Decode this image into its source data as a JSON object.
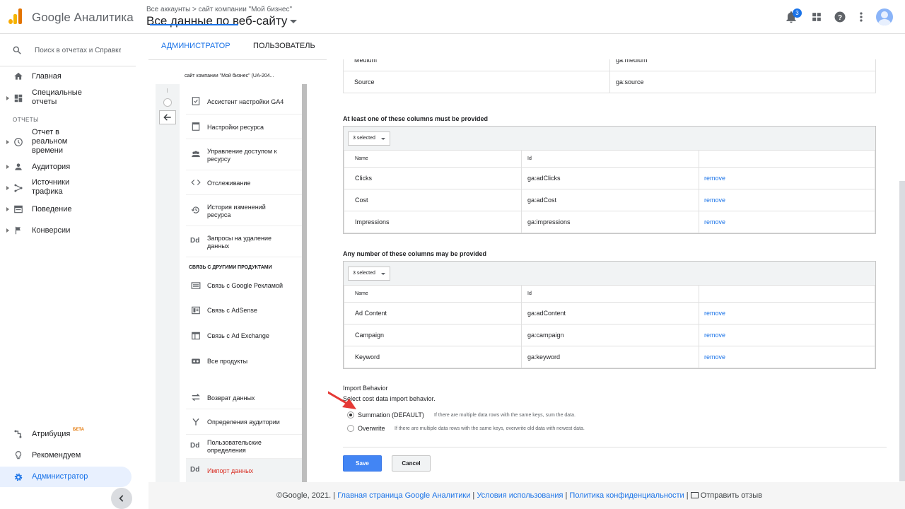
{
  "header": {
    "brand": "Google Аналитика",
    "breadcrumb": "Все аккаунты > сайт компании \"Мой бизнес\"",
    "property": "Все данные по веб-сайту",
    "notifications_count": "3"
  },
  "sidebar": {
    "search_placeholder": "Поиск в отчетах и Справке",
    "home": "Главная",
    "custom_reports": "Специальные отчеты",
    "reports_section": "ОТЧЕТЫ",
    "realtime": "Отчет в реальном времени",
    "audience": "Аудитория",
    "acquisition": "Источники трафика",
    "behavior": "Поведение",
    "conversions": "Конверсии",
    "attribution": "Атрибуция",
    "attribution_badge": "БЕТА",
    "discover": "Рекомендуем",
    "admin": "Администратор"
  },
  "tabs": {
    "admin": "АДМИНИСТРАТОР",
    "user": "ПОЛЬЗОВАТЕЛЬ"
  },
  "property_column": {
    "account": "сайт компании \"Мой бизнес\" (UA-204...",
    "items": [
      "Ассистент настройки GA4",
      "Настройки ресурса",
      "Управление доступом к ресурсу",
      "Отслеживание",
      "История изменений ресурса",
      "Запросы на удаление данных"
    ],
    "linking_header": "СВЯЗЬ С ДРУГИМИ ПРОДУКТАМИ",
    "linking": [
      "Связь с Google Рекламой",
      "Связь с AdSense",
      "Связь с Ad Exchange",
      "Все продукты"
    ],
    "other": [
      "Возврат данных",
      "Определения аудитории",
      "Пользовательские определения",
      "Импорт данных"
    ],
    "dd_label": "Dd"
  },
  "required_rows": [
    {
      "name": "Medium",
      "id": "ga:medium"
    },
    {
      "name": "Source",
      "id": "ga:source"
    }
  ],
  "at_least_one": {
    "title": "At least one of these columns must be provided",
    "selector": "3 selected",
    "col_name": "Name",
    "col_id": "Id",
    "rows": [
      {
        "name": "Clicks",
        "id": "ga:adClicks",
        "action": "remove"
      },
      {
        "name": "Cost",
        "id": "ga:adCost",
        "action": "remove"
      },
      {
        "name": "Impressions",
        "id": "ga:impressions",
        "action": "remove"
      }
    ]
  },
  "any_number": {
    "title": "Any number of these columns may be provided",
    "selector": "3 selected",
    "col_name": "Name",
    "col_id": "Id",
    "rows": [
      {
        "name": "Ad Content",
        "id": "ga:adContent",
        "action": "remove"
      },
      {
        "name": "Campaign",
        "id": "ga:campaign",
        "action": "remove"
      },
      {
        "name": "Keyword",
        "id": "ga:keyword",
        "action": "remove"
      }
    ]
  },
  "import_behavior": {
    "title": "Import Behavior",
    "subtitle": "Select cost data import behavior.",
    "summation_label": "Summation (DEFAULT)",
    "summation_help": "If there are multiple data rows with the same keys, sum the data.",
    "overwrite_label": "Overwrite",
    "overwrite_help": "If there are multiple data rows with the same keys, overwrite old data with newest data.",
    "selected": "summation"
  },
  "buttons": {
    "save": "Save",
    "cancel": "Cancel"
  },
  "footer": {
    "copyright": "©Google, 2021.",
    "sep": "|",
    "home_link": "Главная страница Google Аналитики",
    "terms_link": "Условия использования",
    "privacy_link": "Политика конфиденциальности",
    "feedback": "Отправить отзыв"
  },
  "colors": {
    "accent": "#1a73e8",
    "save": "#4285f4",
    "active_item": "#d93025",
    "arrow": "#e53935"
  }
}
